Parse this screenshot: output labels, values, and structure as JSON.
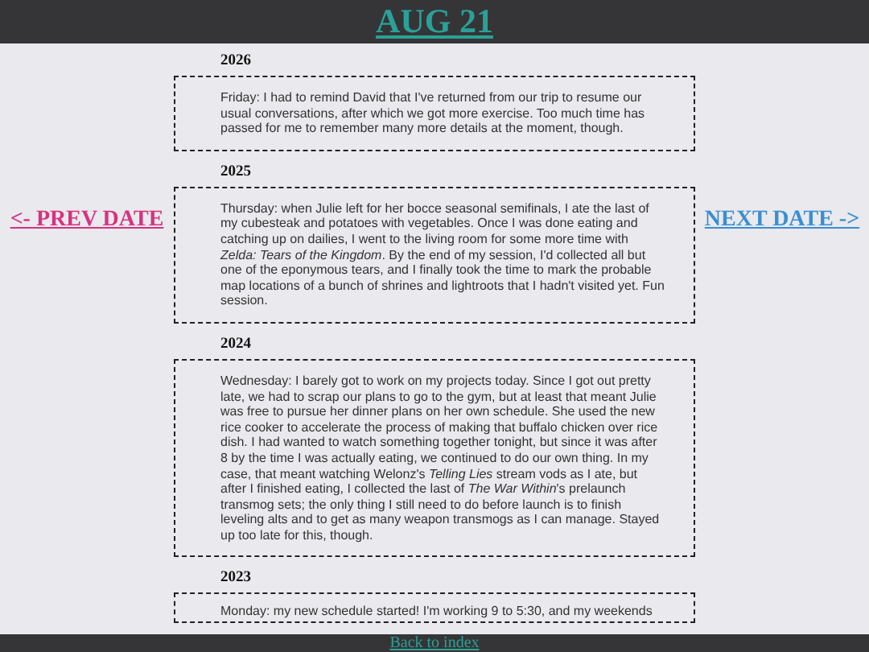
{
  "header": {
    "title": "AUG 21"
  },
  "nav": {
    "prev": "<- PREV DATE",
    "next": "NEXT DATE ->"
  },
  "entries": [
    {
      "year": "2026",
      "text": "Friday: I had to remind David that I've returned from our trip to resume our usual conversations, after which we got more exercise. Too much time has passed for me to remember many more details at the moment, though."
    },
    {
      "year": "2025",
      "text": "Thursday: when Julie left for her bocce seasonal semifinals, I ate the last of my cubesteak and potatoes with vegetables. Once I was done eating and catching up on dailies, I went to the living room for some more time with *Zelda: Tears of the Kingdom*. By the end of my session, I'd collected all but one of the eponymous tears, and I finally took the time to mark the probable map locations of a bunch of shrines and lightroots that I hadn't visited yet. Fun session."
    },
    {
      "year": "2024",
      "text": "Wednesday: I barely got to work on my projects today. Since I got out pretty late, we had to scrap our plans to go to the gym, but at least that meant Julie was free to pursue her dinner plans on her own schedule. She used the new rice cooker to accelerate the process of making that buffalo chicken over rice dish. I had wanted to watch something together tonight, but since it was after 8 by the time I was actually eating, we continued to do our own thing. In my case, that meant watching Welonz's *Telling Lies* stream vods as I ate, but after I finished eating, I collected the last of *The War Within*'s prelaunch transmog sets; the only thing I still need to do before launch is to finish leveling alts and to get as many weapon transmogs as I can manage. Stayed up too late for this, though."
    },
    {
      "year": "2023",
      "text": "Monday: my new schedule started! I'm working 9 to 5:30, and my weekends"
    }
  ],
  "footer": {
    "link": "Back to index"
  }
}
